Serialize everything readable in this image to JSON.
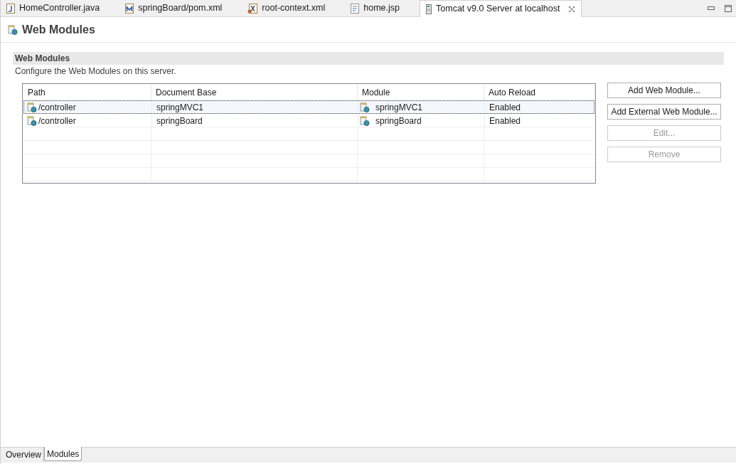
{
  "editor_tabs": [
    {
      "label": "HomeController.java",
      "kind": "java",
      "selected": false
    },
    {
      "label": "springBoard/pom.xml",
      "kind": "maven",
      "selected": false
    },
    {
      "label": "root-context.xml",
      "kind": "xml",
      "selected": false
    },
    {
      "label": "home.jsp",
      "kind": "jsp",
      "selected": false
    },
    {
      "label": "Tomcat v9.0 Server at localhost",
      "kind": "server",
      "selected": true
    }
  ],
  "page_title": "Web Modules",
  "section": {
    "title": "Web Modules",
    "description": "Configure the Web Modules on this server."
  },
  "table": {
    "columns": [
      "Path",
      "Document Base",
      "Module",
      "Auto Reload"
    ],
    "rows": [
      {
        "path": "/controller",
        "document_base": "springMVC1",
        "module": "springMVC1",
        "auto_reload": "Enabled",
        "selected": true
      },
      {
        "path": "/controller",
        "document_base": "springBoard",
        "module": "springBoard",
        "auto_reload": "Enabled",
        "selected": false
      }
    ]
  },
  "buttons": [
    {
      "label": "Add Web Module...",
      "disabled": false
    },
    {
      "label": "Add External Web Module...",
      "disabled": false
    },
    {
      "label": "Edit...",
      "disabled": true
    },
    {
      "label": "Remove",
      "disabled": true
    }
  ],
  "bottom_tabs": [
    {
      "label": "Overview",
      "selected": false
    },
    {
      "label": "Modules",
      "selected": true
    }
  ]
}
